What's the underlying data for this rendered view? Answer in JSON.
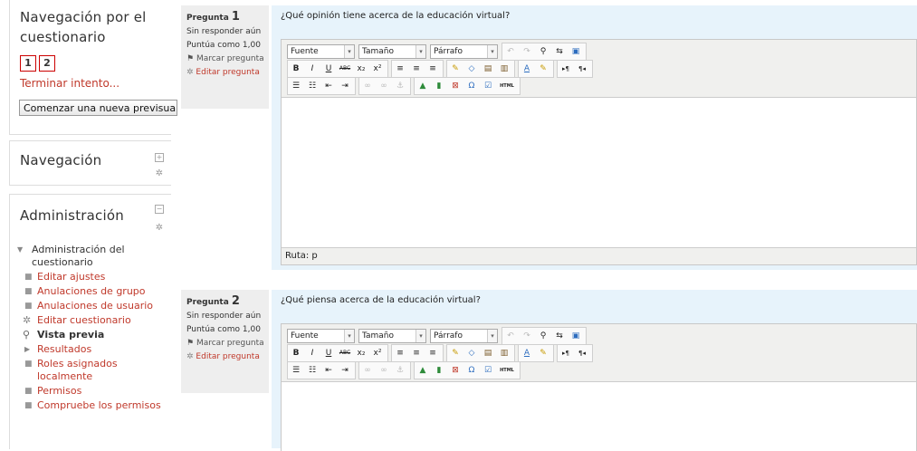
{
  "quiz_nav": {
    "title": "Navegación por el cuestionario",
    "buttons": [
      "1",
      "2"
    ],
    "finish_link": "Terminar intento...",
    "restart_button": "Comenzar una nueva previsualización"
  },
  "nav_block": {
    "title": "Navegación"
  },
  "admin_block": {
    "title": "Administración",
    "root": "Administración del cuestionario",
    "items": [
      "Editar ajustes",
      "Anulaciones de grupo",
      "Anulaciones de usuario",
      "Editar cuestionario",
      "Vista previa",
      "Resultados",
      "Roles asignados localmente",
      "Permisos",
      "Compruebe los permisos"
    ]
  },
  "icons": {
    "dock": "dock-icon",
    "gear": "gear-icon",
    "collapse": "collapse-icon",
    "flag": "flag-icon",
    "magnifier": "magnifier-icon",
    "triangle": "triangle-right-icon"
  },
  "questions": [
    {
      "label": "Pregunta",
      "number": "1",
      "status": "Sin responder aún",
      "grade": "Puntúa como 1,00",
      "flag": "Marcar pregunta",
      "edit": "Editar pregunta",
      "text": "¿Qué opinión tiene acerca de la educación virtual?",
      "path_label": "Ruta: p"
    },
    {
      "label": "Pregunta",
      "number": "2",
      "status": "Sin responder aún",
      "grade": "Puntúa como 1,00",
      "flag": "Marcar pregunta",
      "edit": "Editar pregunta",
      "text": "¿Qué piensa acerca de la educación virtual?",
      "path_label": ""
    }
  ],
  "editor": {
    "font_select": "Fuente",
    "size_select": "Tamaño",
    "format_select": "Párrafo",
    "buttons_row2": [
      "B",
      "I",
      "U",
      "ABC",
      "x₂",
      "x²"
    ],
    "omega": "Ω",
    "html": "HTML"
  },
  "colors": {
    "link": "#c0392b",
    "question_bg": "#e7f3fb",
    "info_bg": "#eeeeee"
  }
}
